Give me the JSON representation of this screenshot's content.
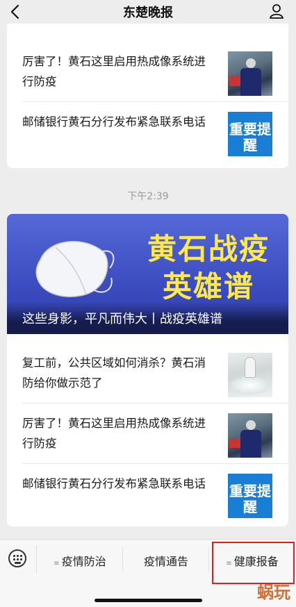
{
  "header": {
    "title": "东楚晚报",
    "back_icon": "chevron-left-icon",
    "profile_icon": "user-icon"
  },
  "card1": {
    "items": [
      {
        "text": "厉害了！黄石这里启用热成像系统进行防疫"
      },
      {
        "text": "邮储银行黄石分行发布紧急联系电话",
        "thumb_label": "重要提醒"
      }
    ]
  },
  "timestamp": "下午2:39",
  "card2": {
    "banner": {
      "headline_line1": "黄石战疫",
      "headline_line2": "英雄谱",
      "caption": "这些身影，平凡而伟大丨战疫英雄谱"
    },
    "items": [
      {
        "text": "复工前，公共区域如何消杀？黄石消防给你做示范了"
      },
      {
        "text": "厉害了！黄石这里启用热成像系统进行防疫"
      },
      {
        "text": "邮储银行黄石分行发布紧急联系电话",
        "thumb_label": "重要提醒"
      }
    ]
  },
  "bottom_menu": {
    "keyboard_icon": "keyboard-icon",
    "items": [
      {
        "label": "疫情防治",
        "has_submenu": true
      },
      {
        "label": "疫情通告",
        "has_submenu": false
      },
      {
        "label": "健康报备",
        "has_submenu": true
      }
    ],
    "highlight_color": "#e02020"
  },
  "watermark": "蜗玩",
  "colors": {
    "background": "#ededed",
    "banner_blue": "#3b4cc0",
    "headline_yellow": "#ffe94a",
    "notice_blue": "#1a7fd4"
  }
}
